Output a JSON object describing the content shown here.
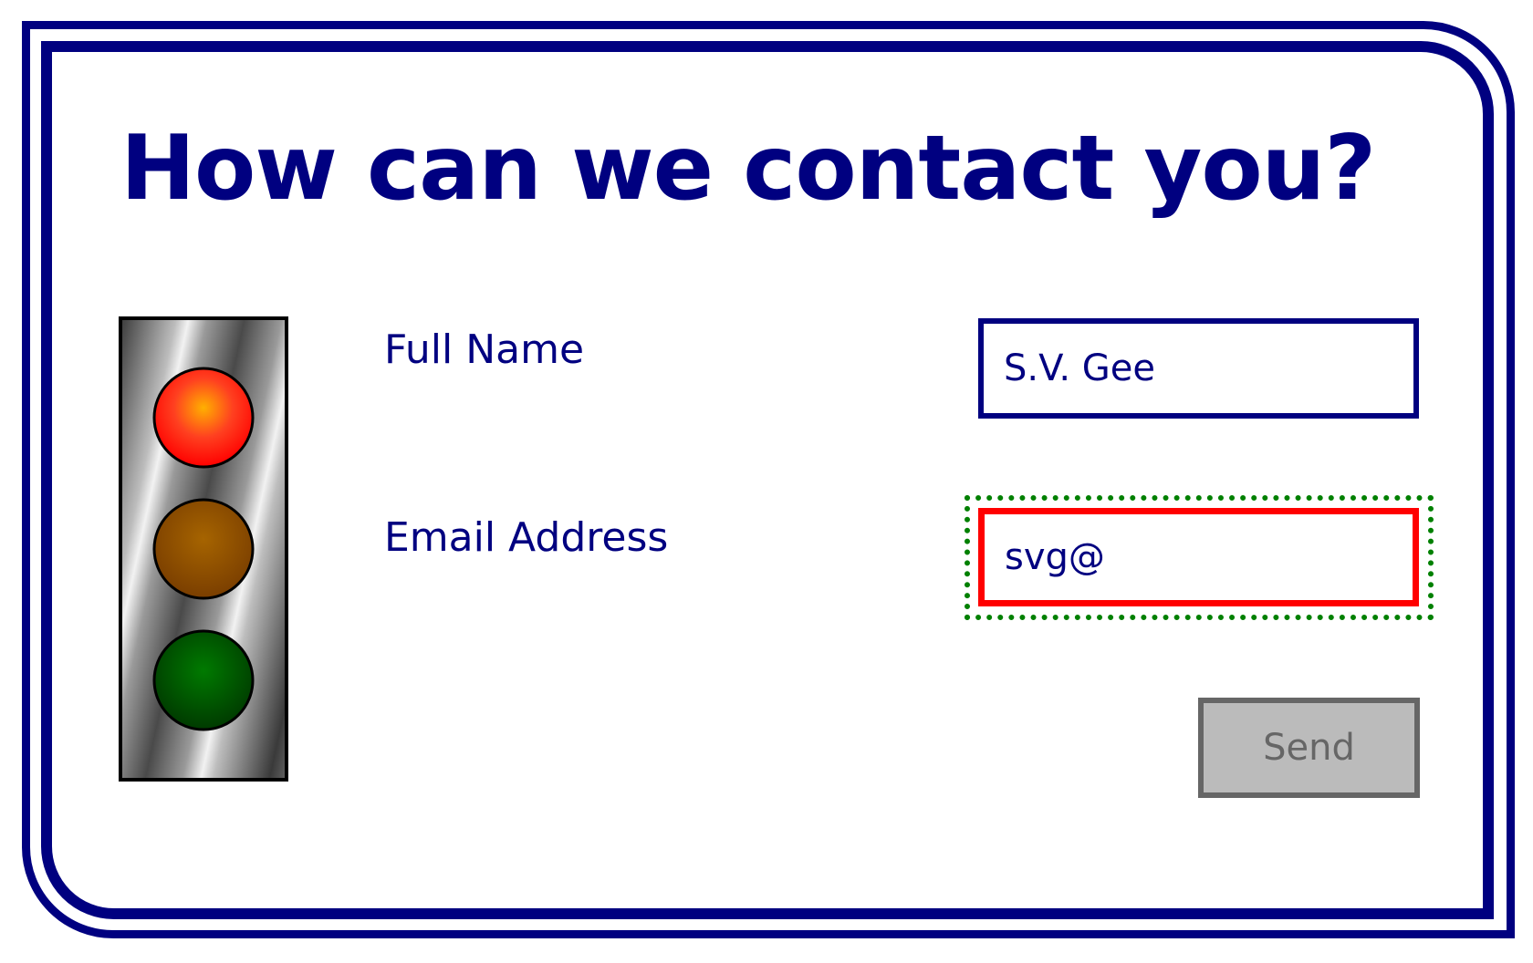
{
  "form": {
    "title": "How can we contact you?",
    "fields": [
      {
        "label": "Full Name",
        "value": "S.V. Gee"
      },
      {
        "label": "Email Address",
        "value": "svg@"
      }
    ],
    "send_label": "Send"
  },
  "traffic_light": {
    "lights": [
      "red-light-icon",
      "amber-light-icon",
      "green-light-icon"
    ],
    "active": "red"
  },
  "colors": {
    "primary": "#000080",
    "error_border": "#ff0000",
    "focus_ring": "#008000",
    "button_bg": "#bbbbbb",
    "button_text": "#666666"
  }
}
